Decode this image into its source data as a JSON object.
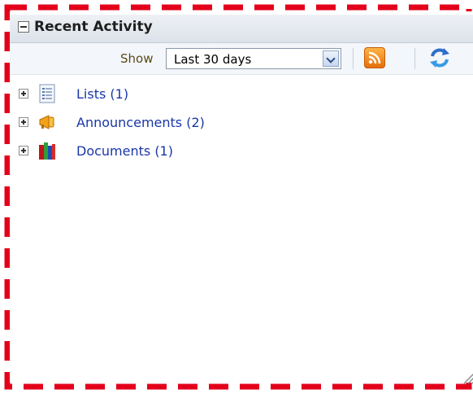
{
  "webpart": {
    "title": "Recent Activity"
  },
  "toolbar": {
    "show_label": "Show",
    "range_selected": "Last 30 days",
    "rss_icon": "rss-feed-icon",
    "refresh_icon": "refresh-icon"
  },
  "items": [
    {
      "label": "Lists (1)",
      "icon": "list-icon"
    },
    {
      "label": "Announcements (2)",
      "icon": "megaphone-icon"
    },
    {
      "label": "Documents (1)",
      "icon": "books-icon"
    }
  ],
  "colors": {
    "frame_dash": "#e3001b",
    "link": "#1a37a8",
    "header_bg": "#dbe2ea"
  }
}
